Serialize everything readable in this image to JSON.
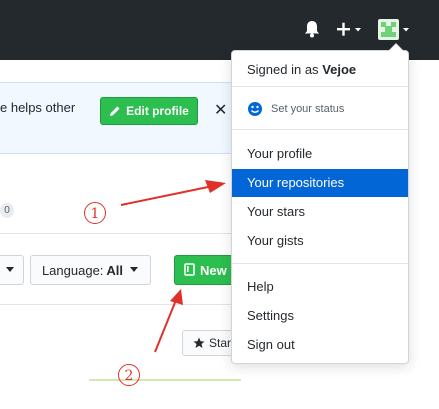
{
  "header": {
    "bell_icon": "bell-icon",
    "plus_icon": "plus-icon",
    "avatar_icon": "avatar-icon"
  },
  "banner": {
    "text": "e helps other",
    "edit_profile_label": "Edit profile",
    "close_label": "✕"
  },
  "repos": {
    "count": "0",
    "language_label": "Language:",
    "language_value": "All",
    "new_label": "New",
    "star_label": "Star"
  },
  "dropdown": {
    "signed_in_prefix": "Signed in as",
    "username": "Vejoe",
    "set_status": "Set your status",
    "items_group1": [
      {
        "label": "Your profile"
      },
      {
        "label": "Your repositories",
        "active": true
      },
      {
        "label": "Your stars"
      },
      {
        "label": "Your gists"
      }
    ],
    "items_group2": [
      {
        "label": "Help"
      },
      {
        "label": "Settings"
      },
      {
        "label": "Sign out"
      }
    ]
  },
  "annotations": {
    "marker_1": "1",
    "marker_2": "2",
    "color": "#e0302a"
  },
  "colors": {
    "topbar": "#24292e",
    "primary_green": "#2cbe4e",
    "active_blue": "#0366d6"
  }
}
